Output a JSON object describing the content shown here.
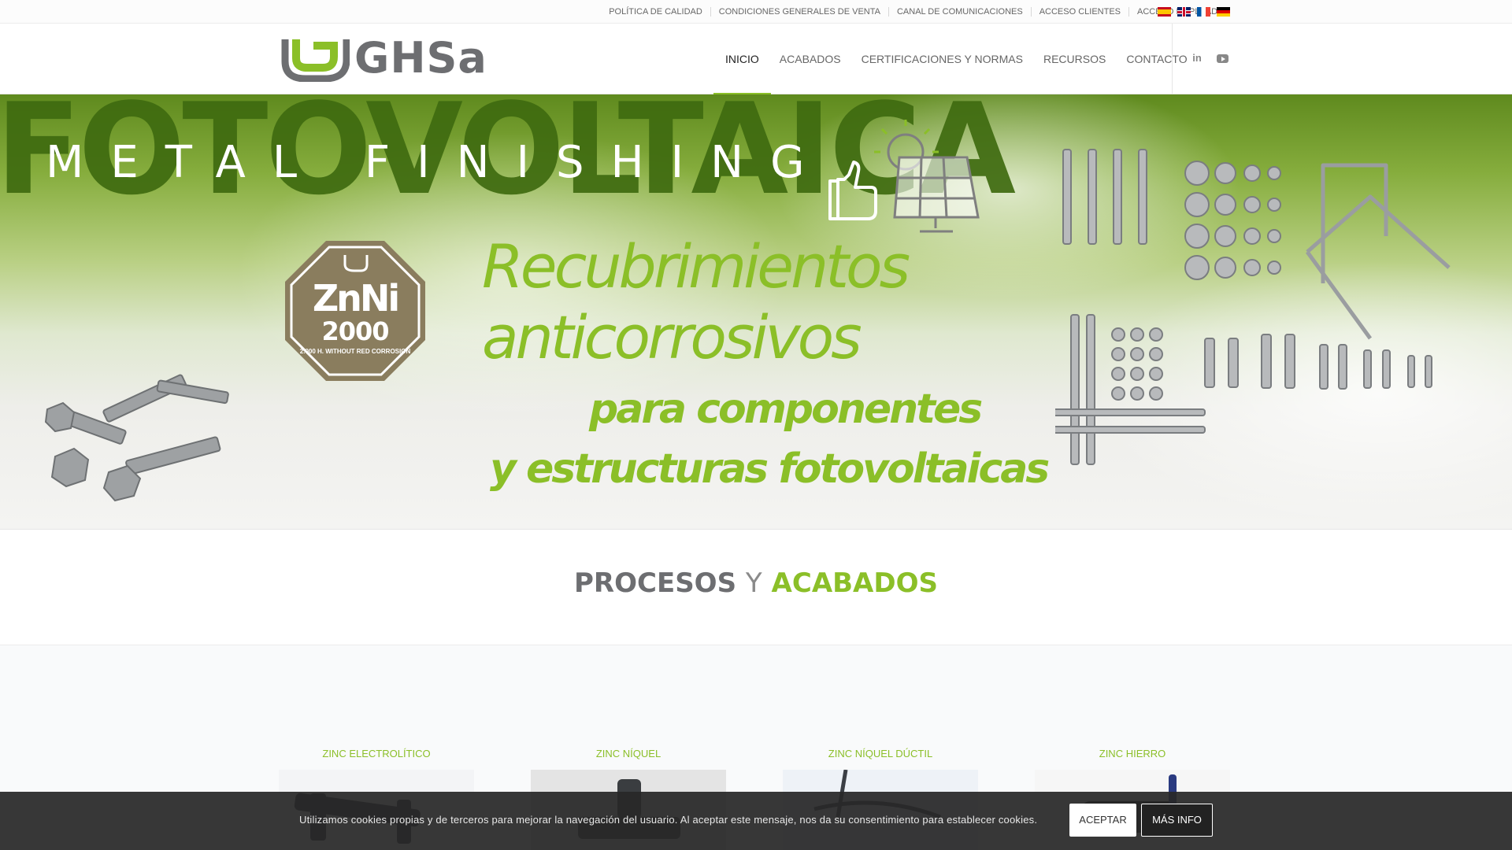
{
  "topbar": {
    "links": [
      "POLÍTICA DE CALIDAD",
      "CONDICIONES GENERALES DE VENTA",
      "CANAL DE COMUNICACIONES",
      "ACCESO CLIENTES",
      "ACCESO EMPLEADOS"
    ],
    "flags": [
      "flag-es-icon",
      "flag-en-icon",
      "flag-fr-icon",
      "flag-de-icon"
    ]
  },
  "header": {
    "logo_text": "GHSa",
    "nav": [
      "INICIO",
      "ACABADOS",
      "CERTIFICACIONES Y NORMAS",
      "RECURSOS",
      "CONTACTO"
    ],
    "active_nav": "INICIO",
    "social": [
      "linkedin-icon",
      "youtube-icon"
    ]
  },
  "hero": {
    "background_word": "FOTOVOLTAICA",
    "metal": "METAL FINISHING",
    "badge_main": "ZnNi",
    "badge_num": "2000",
    "badge_note": "2.000 H. WITHOUT RED CORROSION",
    "line1": "Recubrimientos",
    "line2": "anticorrosivos",
    "line3": "para componentes",
    "line4": "y estructuras fotovoltaicas"
  },
  "section": {
    "title_part1": "PROCESOS",
    "title_part2": "Y",
    "title_part3": "ACABADOS"
  },
  "cards": [
    {
      "title": "ZINC ELECTROLÍTICO"
    },
    {
      "title": "ZINC NÍQUEL"
    },
    {
      "title": "ZINC NÍQUEL DÚCTIL"
    },
    {
      "title": "ZINC HIERRO"
    }
  ],
  "cookie": {
    "text": "Utilizamos cookies propias y de terceros para mejorar la navegación del usuario. Al aceptar este mensaje, nos da su consentimiento para establecer cookies.",
    "accept": "ACEPTAR",
    "info": "MÁS INFO"
  },
  "colors": {
    "brand_green": "#8bbf28",
    "brand_grey": "#6d6e71",
    "dark_green": "#3f6b10"
  }
}
